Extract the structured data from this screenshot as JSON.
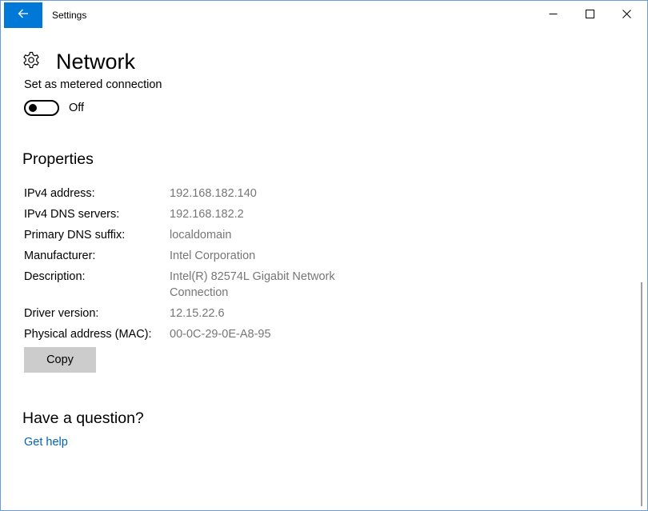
{
  "window": {
    "title": "Settings",
    "accent_color": "#0078d7"
  },
  "icons": {
    "back": "back-arrow-icon",
    "minimize": "minimize-icon",
    "maximize": "maximize-icon",
    "close": "close-icon",
    "page": "gear-icon"
  },
  "header": {
    "title": "Network"
  },
  "metered": {
    "label": "Set as metered connection",
    "state": "Off",
    "enabled": false
  },
  "properties": {
    "title": "Properties",
    "rows": [
      {
        "label": "IPv4 address:",
        "value": "192.168.182.140"
      },
      {
        "label": "IPv4 DNS servers:",
        "value": "192.168.182.2"
      },
      {
        "label": "Primary DNS suffix:",
        "value": "localdomain"
      },
      {
        "label": "Manufacturer:",
        "value": "Intel Corporation"
      },
      {
        "label": "Description:",
        "value": "Intel(R) 82574L Gigabit Network Connection"
      },
      {
        "label": "Driver version:",
        "value": "12.15.22.6"
      },
      {
        "label": "Physical address (MAC):",
        "value": "00-0C-29-0E-A8-95"
      }
    ],
    "copy_label": "Copy"
  },
  "question": {
    "title": "Have a question?",
    "link": "Get help",
    "link_color": "#0063b1"
  }
}
